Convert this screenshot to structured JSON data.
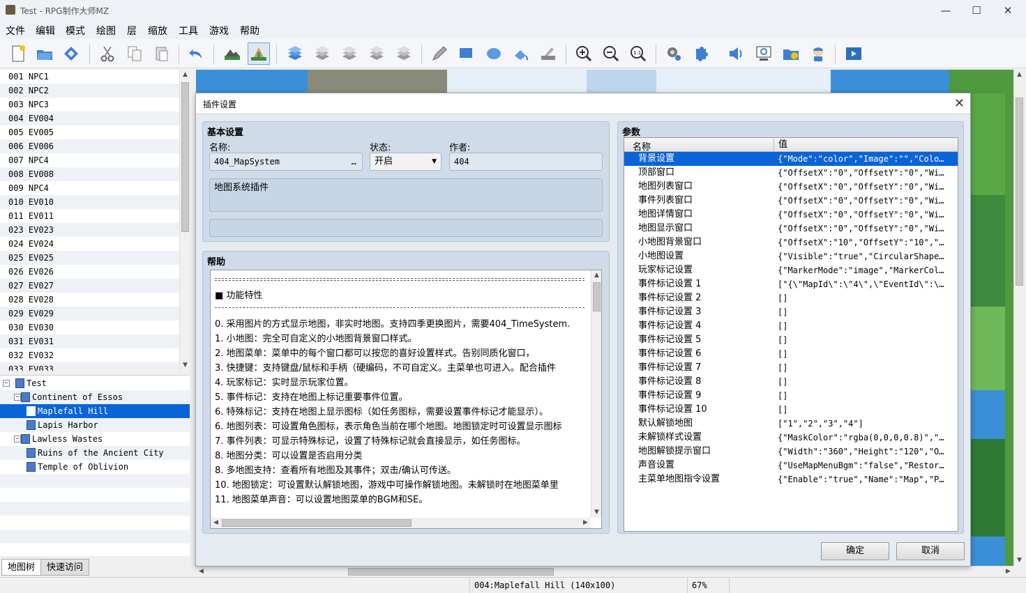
{
  "window": {
    "title": "Test - RPG制作大师MZ",
    "minimize": "—",
    "maximize": "☐",
    "close": "✕"
  },
  "menu": [
    "文件",
    "编辑",
    "模式",
    "绘图",
    "层",
    "缩放",
    "工具",
    "游戏",
    "帮助"
  ],
  "toolbar": {
    "groups": [
      [
        "new-project-icon",
        "open-project-icon",
        "save-project-icon"
      ],
      [
        "cut-icon",
        "copy-icon",
        "paste-icon"
      ],
      [
        "undo-icon"
      ],
      [
        "map-mode-icon",
        "event-mode-icon"
      ],
      [
        "layer-auto-icon",
        "layer-1-icon",
        "layer-2-icon",
        "layer-3-icon",
        "layer-4-icon"
      ],
      [
        "pencil-icon",
        "rectangle-icon",
        "ellipse-icon",
        "flood-fill-icon",
        "shadow-pen-icon"
      ],
      [
        "zoom-in-icon",
        "zoom-out-icon",
        "zoom-actual-icon"
      ],
      [
        "database-icon",
        "plugin-manager-icon",
        "sound-test-icon",
        "event-searcher-icon",
        "resource-manager-icon",
        "character-generator-icon"
      ],
      [
        "playtest-icon"
      ]
    ],
    "active": "event-mode-icon"
  },
  "event_list": [
    "001  NPC1",
    "002  NPC2",
    "003  NPC3",
    "004  EV004",
    "005  EV005",
    "006  EV006",
    "007  NPC4",
    "008  EV008",
    "009  NPC4",
    "010  EV010",
    "011  EV011",
    "023  EV023",
    "024  EV024",
    "025  EV025",
    "026  EV026",
    "027  EV027",
    "028  EV028",
    "029  EV029",
    "030  EV030",
    "031  EV031",
    "032  EV032",
    "033  EV033"
  ],
  "map_tree": [
    {
      "label": "Test",
      "level": 0,
      "toggle": "⊟",
      "selected": false
    },
    {
      "label": "Continent of Essos",
      "level": 1,
      "toggle": "⊟",
      "selected": false
    },
    {
      "label": "Maplefall Hill",
      "level": 2,
      "toggle": "",
      "selected": true
    },
    {
      "label": "Lapis Harbor",
      "level": 2,
      "toggle": "",
      "selected": false
    },
    {
      "label": "Lawless Wastes",
      "level": 1,
      "toggle": "⊟",
      "selected": false
    },
    {
      "label": "Ruins of the Ancient City",
      "level": 2,
      "toggle": "",
      "selected": false
    },
    {
      "label": "Temple of Oblivion",
      "level": 2,
      "toggle": "",
      "selected": false
    }
  ],
  "tabs": {
    "map_tree": "地图树",
    "quick_access": "快速访问"
  },
  "status": {
    "map": "004:Maplefall Hill (140x100)",
    "zoom": "67%"
  },
  "dialog": {
    "title": "插件设置",
    "close": "✕",
    "basic": {
      "heading": "基本设置",
      "name_label": "名称:",
      "name_value": "404_MapSystem",
      "browse": "…",
      "status_label": "状态:",
      "status_value": "开启",
      "author_label": "作者:",
      "author_value": "404",
      "description": "地图系统插件"
    },
    "help": {
      "heading": "帮助",
      "section": "■ 功能特性",
      "lines": [
        "0.   采用图片的方式显示地图，非实时地图。支持四季更换图片，需要404_TimeSystem.",
        "1.   小地图：完全可自定义的小地图背景窗口样式。",
        "2.   地图菜单：菜单中的每个窗口都可以按您的喜好设置样式。告别同质化窗口，",
        "3.   快捷键：支持键盘/鼠标和手柄（硬编码，不可自定义。主菜单也可进入。配合插件",
        "4.   玩家标记：实时显示玩家位置。",
        "5.   事件标记：支持在地图上标记重要事件位置。",
        "6.   特殊标记：支持在地图上显示图标（如任务图标，需要设置事件标记才能显示）。",
        "6.   地图列表：可设置角色图标，表示角色当前在哪个地图。地图锁定时可设置显示图标",
        "7.   事件列表：可显示特殊标记，设置了特殊标记就会直接显示，如任务图标。",
        "8.   地图分类：可以设置是否启用分类",
        "8.   多地图支持：查看所有地图及其事件；双击/确认可传送。",
        "10.  地图锁定：可设置默认解锁地图，游戏中可操作解锁地图。未解锁时在地图菜单里",
        "11.  地图菜单声音：可以设置地图菜单的BGM和SE。"
      ]
    },
    "params": {
      "heading": "参数",
      "col_name": "名称",
      "col_value": "值",
      "rows": [
        {
          "name": "背景设置",
          "value": "{\"Mode\":\"color\",\"Image\":\"\",\"Colo…"
        },
        {
          "name": "顶部窗口",
          "value": "{\"OffsetX\":\"0\",\"OffsetY\":\"0\",\"Wi…"
        },
        {
          "name": "地图列表窗口",
          "value": "{\"OffsetX\":\"0\",\"OffsetY\":\"0\",\"Wi…"
        },
        {
          "name": "事件列表窗口",
          "value": "{\"OffsetX\":\"0\",\"OffsetY\":\"0\",\"Wi…"
        },
        {
          "name": "地图详情窗口",
          "value": "{\"OffsetX\":\"0\",\"OffsetY\":\"0\",\"Wi…"
        },
        {
          "name": "地图显示窗口",
          "value": "{\"OffsetX\":\"0\",\"OffsetY\":\"0\",\"Wi…"
        },
        {
          "name": "小地图背景窗口",
          "value": "{\"OffsetX\":\"10\",\"OffsetY\":\"10\",\"…"
        },
        {
          "name": "小地图设置",
          "value": "{\"Visible\":\"true\",\"CircularShape…"
        },
        {
          "name": "玩家标记设置",
          "value": "{\"MarkerMode\":\"image\",\"MarkerCol…"
        },
        {
          "name": "事件标记设置 1",
          "value": "[\"{\\\"MapId\\\":\\\"4\\\",\\\"EventId\\\":\\…"
        },
        {
          "name": "事件标记设置 2",
          "value": "[]"
        },
        {
          "name": "事件标记设置 3",
          "value": "[]"
        },
        {
          "name": "事件标记设置 4",
          "value": "[]"
        },
        {
          "name": "事件标记设置 5",
          "value": "[]"
        },
        {
          "name": "事件标记设置 6",
          "value": "[]"
        },
        {
          "name": "事件标记设置 7",
          "value": "[]"
        },
        {
          "name": "事件标记设置 8",
          "value": "[]"
        },
        {
          "name": "事件标记设置 9",
          "value": "[]"
        },
        {
          "name": "事件标记设置 10",
          "value": "[]"
        },
        {
          "name": "默认解锁地图",
          "value": "[\"1\",\"2\",\"3\",\"4\"]"
        },
        {
          "name": "未解锁样式设置",
          "value": "{\"MaskColor\":\"rgba(0,0,0,0.8)\",\"…"
        },
        {
          "name": "地图解锁提示窗口",
          "value": "{\"Width\":\"360\",\"Height\":\"120\",\"O…"
        },
        {
          "name": "声音设置",
          "value": "{\"UseMapMenuBgm\":\"false\",\"Restor…"
        },
        {
          "name": "主菜单地图指令设置",
          "value": "{\"Enable\":\"true\",\"Name\":\"Map\",\"P…"
        }
      ]
    },
    "ok": "确定",
    "cancel": "取消"
  },
  "colors": {
    "selection": "#0a64d8",
    "panel": "#cfdbe8",
    "map_green": "#3a7a3a",
    "water": "#3a8fd8"
  }
}
